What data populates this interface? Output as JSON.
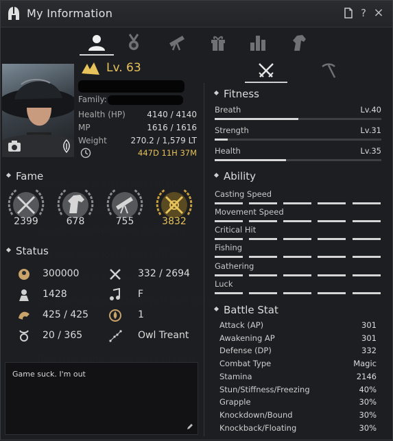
{
  "window": {
    "title": "My Information"
  },
  "title_buttons": {
    "memo_icon": "memo-icon",
    "help": "?",
    "close": "×"
  },
  "tabs": [
    "profile-icon",
    "medal-icon",
    "telescope-icon",
    "gift-icon",
    "chart-icon",
    "horse-icon"
  ],
  "character": {
    "level": "Lv. 63",
    "family_label": "Family:",
    "health_label": "Health (HP)",
    "health_value": "4140 / 4140",
    "mp_label": "MP",
    "mp_value": "1616 / 1616",
    "weight_label": "Weight",
    "weight_value": "270.2 / 1,579 LT",
    "time_value": "447D 11H 37M"
  },
  "fame": {
    "title": "Fame",
    "items": [
      {
        "icon": "crossed-swords-icon",
        "value": "2399"
      },
      {
        "icon": "horse-head-icon",
        "value": "678"
      },
      {
        "icon": "telescope-icon",
        "value": "755"
      },
      {
        "icon": "crossed-swords-gold-icon",
        "value": "3832"
      }
    ]
  },
  "status": {
    "title": "Status",
    "rows": [
      {
        "icon": "contribution-icon",
        "value": "300000"
      },
      {
        "icon": "tools-icon",
        "value": "332 / 2694"
      },
      {
        "icon": "rank-icon",
        "value": "1428"
      },
      {
        "icon": "music-icon",
        "value": "F"
      },
      {
        "icon": "strength-icon",
        "value": "425 / 425"
      },
      {
        "icon": "energy-icon",
        "value": "1"
      },
      {
        "icon": "zodiac-icon",
        "value": "20 / 365"
      },
      {
        "icon": "constellation-icon",
        "value": "Owl Treant"
      }
    ]
  },
  "chat": {
    "text": "Game suck. I'm out"
  },
  "fitness": {
    "title": "Fitness",
    "rows": [
      {
        "label": "Breath",
        "value": "Lv.40",
        "progress": 0.5
      },
      {
        "label": "Strength",
        "value": "Lv.31",
        "progress": 0.08
      },
      {
        "label": "Health",
        "value": "Lv.35",
        "progress": 0.43
      }
    ]
  },
  "ability": {
    "title": "Ability",
    "rows": [
      {
        "label": "Casting Speed",
        "level": 5
      },
      {
        "label": "Movement Speed",
        "level": 5
      },
      {
        "label": "Critical Hit",
        "level": 5
      },
      {
        "label": "Fishing",
        "level": 5
      },
      {
        "label": "Gathering",
        "level": 5
      },
      {
        "label": "Luck",
        "level": 5
      }
    ]
  },
  "battle_stat": {
    "title": "Battle Stat",
    "rows": [
      {
        "label": "Attack (AP)",
        "value": "301"
      },
      {
        "label": "Awakening AP",
        "value": "301"
      },
      {
        "label": "Defense (DP)",
        "value": "332"
      },
      {
        "label": "Combat Type",
        "value": "Magic"
      },
      {
        "label": "Stamina",
        "value": "2146"
      },
      {
        "label": "Stun/Stiffness/Freezing",
        "value": "40%"
      },
      {
        "label": "Grapple",
        "value": "30%"
      },
      {
        "label": "Knockdown/Bound",
        "value": "30%"
      },
      {
        "label": "Knockback/Floating",
        "value": "30%"
      }
    ]
  },
  "colors": {
    "accent_gold": "#e8c25a",
    "bar": "#d8d8d8"
  }
}
